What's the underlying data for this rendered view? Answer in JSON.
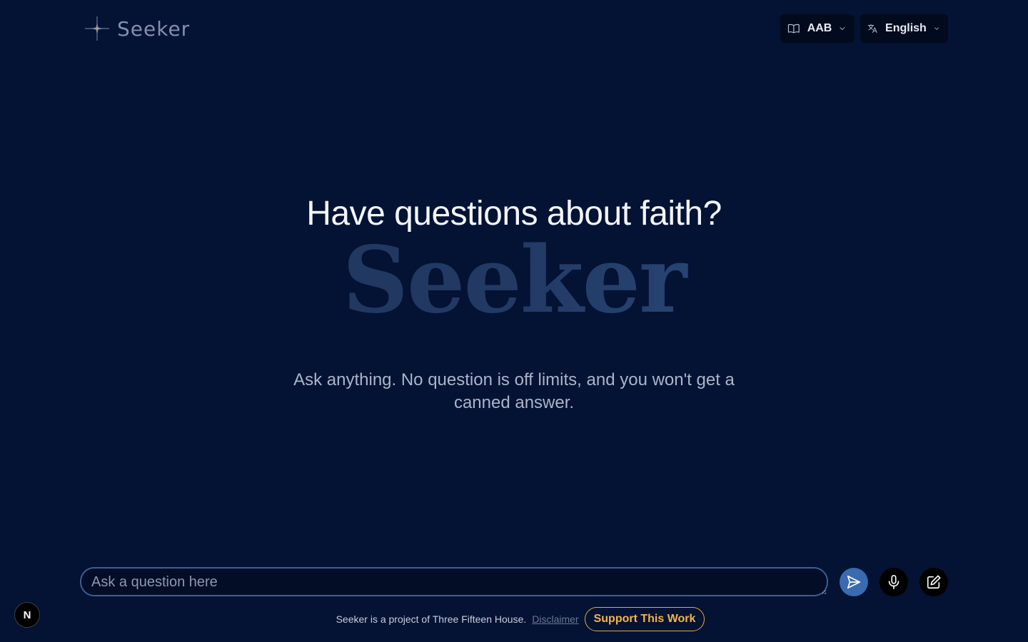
{
  "header": {
    "logo_text": "Seeker",
    "bible_version": {
      "selected": "AAB"
    },
    "language": {
      "selected": "English"
    }
  },
  "hero": {
    "title": "Have questions about faith?",
    "wordmark": "Seeker",
    "subtitle": "Ask anything. No question is off limits, and you won't get a canned answer."
  },
  "composer": {
    "placeholder": "Ask a question here",
    "value": ""
  },
  "footer": {
    "text": "Seeker is a project of Three Fifteen House.",
    "disclaimer": "Disclaimer",
    "support": "Support This Work"
  },
  "dev_badge": {
    "label": "N"
  },
  "icons": {
    "logo": "compass-star-icon",
    "bible_version": "book-open-icon",
    "language": "translate-icon",
    "send": "send-icon",
    "mic": "microphone-icon",
    "new_chat": "edit-icon"
  },
  "colors": {
    "background": "#041233",
    "accent": "#3a6ab0",
    "support": "#f5b545"
  }
}
